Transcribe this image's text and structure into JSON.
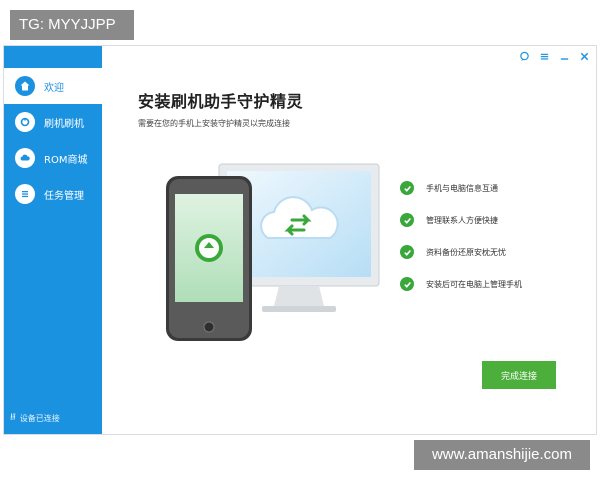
{
  "watermark_top": "TG: MYYJJPP",
  "watermark_bottom": "www.amanshijie.com",
  "sidebar": {
    "items": [
      {
        "label": "欢迎",
        "icon": "home-icon"
      },
      {
        "label": "刷机刷机",
        "icon": "flash-icon"
      },
      {
        "label": "ROM商城",
        "icon": "cloud-icon"
      },
      {
        "label": "任务管理",
        "icon": "list-icon"
      }
    ],
    "footer": "设备已连接",
    "active_index": 0
  },
  "titlebar": {
    "buttons": [
      {
        "icon": "feedback-icon"
      },
      {
        "icon": "menu-icon"
      },
      {
        "icon": "minimize-icon"
      },
      {
        "icon": "close-icon"
      }
    ]
  },
  "main": {
    "title": "安装刷机助手守护精灵",
    "subtitle": "需要在您的手机上安装守护精灵以完成连接",
    "checklist": [
      "手机与电脑信息互通",
      "管理联系人方便快捷",
      "资料备份还原安枕无忧",
      "安装后可在电脑上管理手机"
    ],
    "finish_button": "完成连接"
  },
  "colors": {
    "accent": "#1b92e0",
    "success": "#3aa73a",
    "button_green": "#4caf3c"
  }
}
